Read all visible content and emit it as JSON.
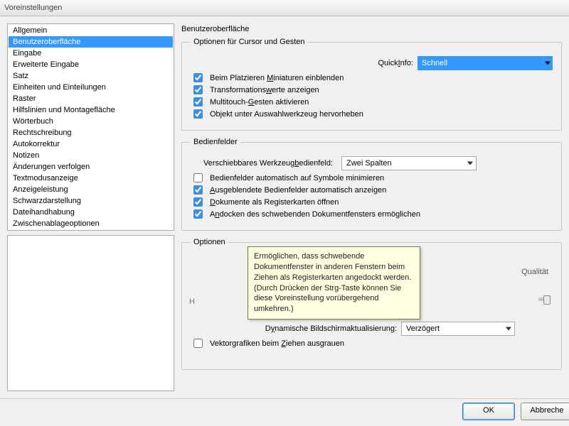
{
  "window": {
    "title": "Voreinstellungen"
  },
  "sidebar": {
    "items": [
      "Allgemein",
      "Benutzeroberfläche",
      "Eingabe",
      "Erweiterte Eingabe",
      "Satz",
      "Einheiten und Einteilungen",
      "Raster",
      "Hilfslinien und Montagefläche",
      "Wörterbuch",
      "Rechtschreibung",
      "Autokorrektur",
      "Notizen",
      "Änderungen verfolgen",
      "Textmodusanzeige",
      "Anzeigeleistung",
      "Schwarzdarstellung",
      "Dateihandhabung",
      "Zwischenablageoptionen"
    ]
  },
  "main": {
    "title": "Benutzeroberfläche",
    "group_cursor": {
      "legend": "Optionen für Cursor und Gesten",
      "quickinfo_label_pre": "Quick",
      "quickinfo_label_u": "I",
      "quickinfo_label_post": "nfo:",
      "quickinfo_value": "Schnell",
      "chk1_pre": "Beim Platzieren ",
      "chk1_u": "M",
      "chk1_post": "iniaturen einblenden",
      "chk2_pre": "Transformations",
      "chk2_u": "w",
      "chk2_post": "erte anzeigen",
      "chk3_pre": "Multitouch-",
      "chk3_u": "G",
      "chk3_post": "esten aktivieren",
      "chk4": "Objekt unter Auswahlwerkzeug hervorheben"
    },
    "group_panels": {
      "legend": "Bedienfelder",
      "tool_label_pre": "Verschiebbares Werkzeug",
      "tool_label_u": "b",
      "tool_label_post": "edienfeld:",
      "tool_value": "Zwei Spalten",
      "chk1": "Bedienfelder automatisch auf Symbole minimieren",
      "chk2_u": "A",
      "chk2_post": "usgeblendete Bedienfelder automatisch anzeigen",
      "chk3_u": "D",
      "chk3_post": "okumente als Registerkarten öffnen",
      "chk4_pre": "A",
      "chk4_u": "n",
      "chk4_post": "docken des schwebenden Dokumentfensters ermöglichen"
    },
    "group_options": {
      "legend": "Optionen",
      "tooltip": "Ermöglichen, dass schwebende Dokumentfenster in anderen Fenstern beim Ziehen als Registerkarten angedockt werden. (Durch Drücken der Strg-Taste können Sie diese Voreinstellung vorübergehend umkehren.)",
      "quality_fragment": "Qualität",
      "h_frag": "H",
      "dyn_label_pre": "D",
      "dyn_label_u": "y",
      "dyn_label_post": "namische Bildschirmaktualisierung:",
      "dyn_value": "Verzögert",
      "chk_vec_pre": "Vektorgrafiken beim ",
      "chk_vec_u": "Z",
      "chk_vec_post": "iehen ausgrauen"
    }
  },
  "footer": {
    "ok": "OK",
    "cancel": "Abbreche"
  }
}
